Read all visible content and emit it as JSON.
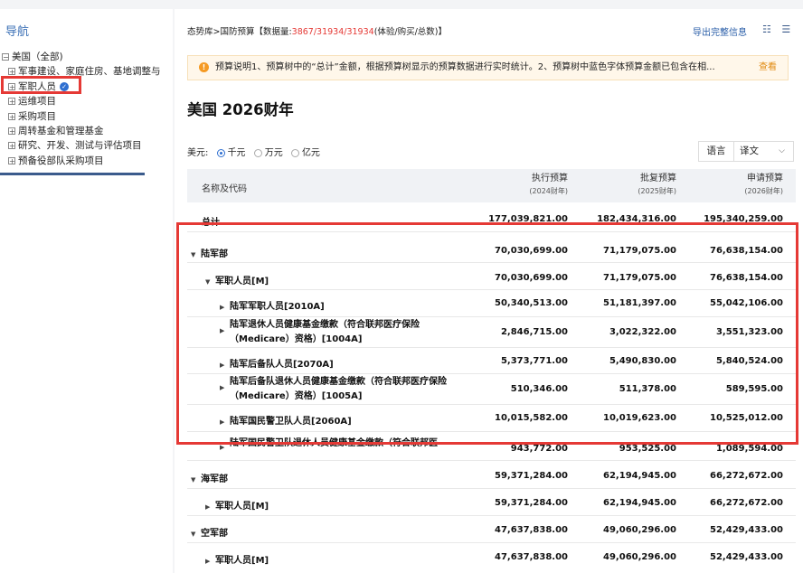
{
  "sidebar": {
    "title": "导航",
    "items": [
      {
        "toggle": "−",
        "label": "美国（全部)",
        "level": "root"
      },
      {
        "toggle": "+",
        "label": "军事建设、家庭住房、基地调整与",
        "level": "child"
      },
      {
        "toggle": "+",
        "label": "军职人员",
        "level": "child",
        "selected": true
      },
      {
        "toggle": "+",
        "label": "运维项目",
        "level": "child"
      },
      {
        "toggle": "+",
        "label": "采购项目",
        "level": "child"
      },
      {
        "toggle": "+",
        "label": "周转基金和管理基金",
        "level": "child"
      },
      {
        "toggle": "+",
        "label": "研究、开发、测试与评估项目",
        "level": "child"
      },
      {
        "toggle": "+",
        "label": "预备役部队采购项目",
        "level": "child"
      }
    ]
  },
  "header": {
    "breadcrumb_prefix": "态势库>国防预算【数据量:",
    "count": "3867/31934/31934",
    "breadcrumb_suffix": "(体验/购买/总数)】",
    "export_label": "导出完整信息",
    "view_icons": "☷ ☰"
  },
  "notice": {
    "icon": "!",
    "text": "预算说明1、预算树中的“总计”金额，根据预算树显示的预算数据进行实时统计。2、预算树中蓝色字体预算金额已包含在相...",
    "link": "查看"
  },
  "page_title": "美国 2026财年",
  "units": {
    "label": "美元:",
    "options": [
      "千元",
      "万元",
      "亿元"
    ],
    "selected": "千元"
  },
  "language": {
    "label": "语言",
    "value": "译文",
    "caret": "⌵"
  },
  "table": {
    "header": {
      "name": "名称及代码",
      "col1": "执行预算",
      "col1_sub": "(2024财年)",
      "col2": "批复预算",
      "col2_sub": "(2025财年)",
      "col3": "申请预算",
      "col3_sub": "(2026财年)"
    },
    "rows": [
      {
        "name": "总计",
        "v1": "177,039,821.00",
        "v2": "182,434,316.00",
        "v3": "195,340,259.00",
        "caret": ""
      },
      {
        "name": "陆军部",
        "v1": "70,030,699.00",
        "v2": "71,179,075.00",
        "v3": "76,638,154.00",
        "caret": "▼"
      },
      {
        "name": "军职人员[M]",
        "v1": "70,030,699.00",
        "v2": "71,179,075.00",
        "v3": "76,638,154.00",
        "caret": "▼"
      },
      {
        "name": "陆军军职人员[2010A]",
        "v1": "50,340,513.00",
        "v2": "51,181,397.00",
        "v3": "55,042,106.00",
        "caret": "▶"
      },
      {
        "name": "陆军退休人员健康基金缴款（符合联邦医疗保险（Medicare）资格）[1004A]",
        "v1": "2,846,715.00",
        "v2": "3,022,322.00",
        "v3": "3,551,323.00",
        "caret": "▶"
      },
      {
        "name": "陆军后备队人员[2070A]",
        "v1": "5,373,771.00",
        "v2": "5,490,830.00",
        "v3": "5,840,524.00",
        "caret": "▶"
      },
      {
        "name": "陆军后备队退休人员健康基金缴款（符合联邦医疗保险（Medicare）资格）[1005A]",
        "v1": "510,346.00",
        "v2": "511,378.00",
        "v3": "589,595.00",
        "caret": "▶"
      },
      {
        "name": "陆军国民警卫队人员[2060A]",
        "v1": "10,015,582.00",
        "v2": "10,019,623.00",
        "v3": "10,525,012.00",
        "caret": "▶"
      },
      {
        "name": "陆军国民警卫队退休人员健康基金缴款（符合联邦医",
        "v1": "943,772.00",
        "v2": "953,525.00",
        "v3": "1,089,594.00",
        "caret": "▶"
      },
      {
        "name": "海军部",
        "v1": "59,371,284.00",
        "v2": "62,194,945.00",
        "v3": "66,272,672.00",
        "caret": "▼"
      },
      {
        "name": "军职人员[M]",
        "v1": "59,371,284.00",
        "v2": "62,194,945.00",
        "v3": "66,272,672.00",
        "caret": "▶"
      },
      {
        "name": "空军部",
        "v1": "47,637,838.00",
        "v2": "49,060,296.00",
        "v3": "52,429,433.00",
        "caret": "▼"
      },
      {
        "name": "军职人员[M]",
        "v1": "47,637,838.00",
        "v2": "49,060,296.00",
        "v3": "52,429,433.00",
        "caret": "▶"
      }
    ]
  },
  "colors": {
    "accent": "#2f6fd0",
    "highlight": "#e53935",
    "link_orange": "#e08a10",
    "count_red": "#e53935"
  }
}
